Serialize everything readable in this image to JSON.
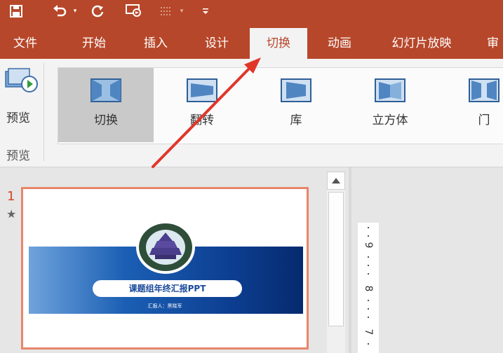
{
  "quick_access": {
    "save_icon": "save-icon",
    "undo_icon": "undo-icon",
    "redo_icon": "redo-icon",
    "present_icon": "present-from-start-icon",
    "customize_icon": "customize-toolbar-icon"
  },
  "tabs": [
    {
      "label": "文件"
    },
    {
      "label": "开始"
    },
    {
      "label": "插入"
    },
    {
      "label": "设计"
    },
    {
      "label": "切换"
    },
    {
      "label": "动画"
    },
    {
      "label": "幻灯片放映"
    },
    {
      "label": "审"
    }
  ],
  "active_tab": "切换",
  "ribbon": {
    "preview_button_label": "预览",
    "preview_group_label": "预览",
    "transitions": [
      {
        "label": "切换",
        "icon": "transition-cut-icon",
        "selected": true
      },
      {
        "label": "翻转",
        "icon": "transition-flip-icon",
        "selected": false
      },
      {
        "label": "库",
        "icon": "transition-gallery-icon",
        "selected": false
      },
      {
        "label": "立方体",
        "icon": "transition-cube-icon",
        "selected": false
      },
      {
        "label": "门",
        "icon": "transition-door-icon",
        "selected": false
      }
    ]
  },
  "thumbnail_pane": {
    "slide_number": "1",
    "animation_marker": "★",
    "slide": {
      "title": "课题组年终汇报PPT",
      "subtitle": "汇报人：黑晓军"
    }
  },
  "ruler": {
    "labels": [
      "9",
      "8",
      "7"
    ]
  },
  "colors": {
    "accent": "#b7472a",
    "ribbon_bg": "#f3f3f3",
    "annotation_arrow": "#e0362a"
  }
}
